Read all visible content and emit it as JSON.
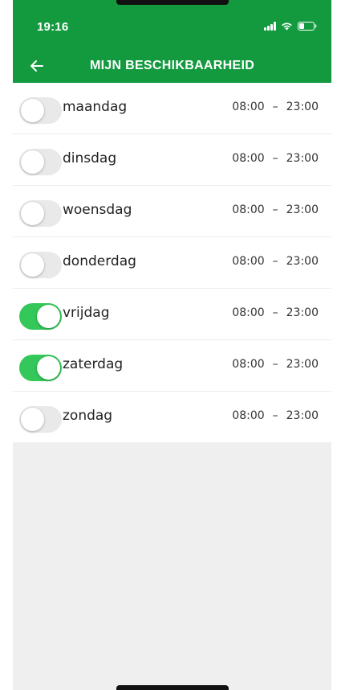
{
  "status_bar": {
    "time": "19:16",
    "signal_icon": "cellular-signal-icon",
    "wifi_icon": "wifi-icon",
    "battery_icon": "battery-icon"
  },
  "header": {
    "title": "MIJN BESCHIKBAARHEID",
    "back_icon": "back-arrow-icon",
    "color": "#139a3f"
  },
  "colors": {
    "toggle_on": "#34c759",
    "toggle_off": "#e9e9ea"
  },
  "days": [
    {
      "label": "maandag",
      "enabled": false,
      "start": "08:00",
      "separator": "–",
      "end": "23:00"
    },
    {
      "label": "dinsdag",
      "enabled": false,
      "start": "08:00",
      "separator": "–",
      "end": "23:00"
    },
    {
      "label": "woensdag",
      "enabled": false,
      "start": "08:00",
      "separator": "–",
      "end": "23:00"
    },
    {
      "label": "donderdag",
      "enabled": false,
      "start": "08:00",
      "separator": "–",
      "end": "23:00"
    },
    {
      "label": "vrijdag",
      "enabled": true,
      "start": "08:00",
      "separator": "–",
      "end": "23:00"
    },
    {
      "label": "zaterdag",
      "enabled": true,
      "start": "08:00",
      "separator": "–",
      "end": "23:00"
    },
    {
      "label": "zondag",
      "enabled": false,
      "start": "08:00",
      "separator": "–",
      "end": "23:00"
    }
  ]
}
